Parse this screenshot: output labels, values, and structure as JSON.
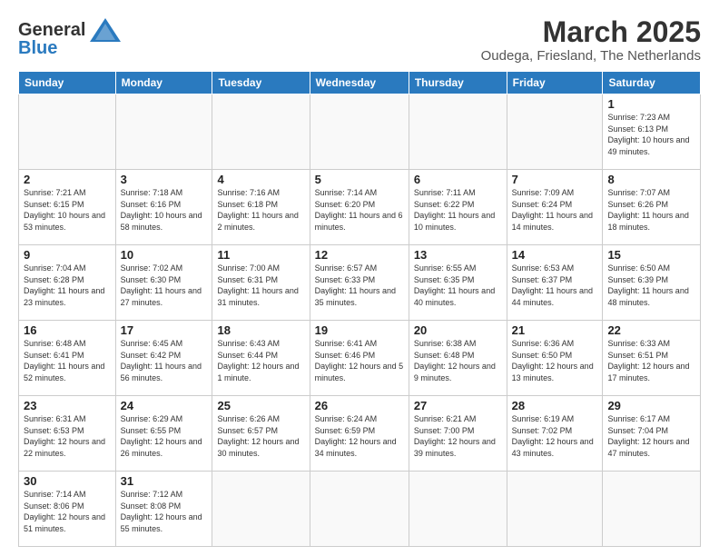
{
  "header": {
    "logo_general": "General",
    "logo_blue": "Blue",
    "title": "March 2025",
    "subtitle": "Oudega, Friesland, The Netherlands"
  },
  "days_of_week": [
    "Sunday",
    "Monday",
    "Tuesday",
    "Wednesday",
    "Thursday",
    "Friday",
    "Saturday"
  ],
  "weeks": [
    [
      {
        "day": "",
        "info": ""
      },
      {
        "day": "",
        "info": ""
      },
      {
        "day": "",
        "info": ""
      },
      {
        "day": "",
        "info": ""
      },
      {
        "day": "",
        "info": ""
      },
      {
        "day": "",
        "info": ""
      },
      {
        "day": "1",
        "info": "Sunrise: 7:23 AM\nSunset: 6:13 PM\nDaylight: 10 hours and 49 minutes."
      }
    ],
    [
      {
        "day": "2",
        "info": "Sunrise: 7:21 AM\nSunset: 6:15 PM\nDaylight: 10 hours and 53 minutes."
      },
      {
        "day": "3",
        "info": "Sunrise: 7:18 AM\nSunset: 6:16 PM\nDaylight: 10 hours and 58 minutes."
      },
      {
        "day": "4",
        "info": "Sunrise: 7:16 AM\nSunset: 6:18 PM\nDaylight: 11 hours and 2 minutes."
      },
      {
        "day": "5",
        "info": "Sunrise: 7:14 AM\nSunset: 6:20 PM\nDaylight: 11 hours and 6 minutes."
      },
      {
        "day": "6",
        "info": "Sunrise: 7:11 AM\nSunset: 6:22 PM\nDaylight: 11 hours and 10 minutes."
      },
      {
        "day": "7",
        "info": "Sunrise: 7:09 AM\nSunset: 6:24 PM\nDaylight: 11 hours and 14 minutes."
      },
      {
        "day": "8",
        "info": "Sunrise: 7:07 AM\nSunset: 6:26 PM\nDaylight: 11 hours and 18 minutes."
      }
    ],
    [
      {
        "day": "9",
        "info": "Sunrise: 7:04 AM\nSunset: 6:28 PM\nDaylight: 11 hours and 23 minutes."
      },
      {
        "day": "10",
        "info": "Sunrise: 7:02 AM\nSunset: 6:30 PM\nDaylight: 11 hours and 27 minutes."
      },
      {
        "day": "11",
        "info": "Sunrise: 7:00 AM\nSunset: 6:31 PM\nDaylight: 11 hours and 31 minutes."
      },
      {
        "day": "12",
        "info": "Sunrise: 6:57 AM\nSunset: 6:33 PM\nDaylight: 11 hours and 35 minutes."
      },
      {
        "day": "13",
        "info": "Sunrise: 6:55 AM\nSunset: 6:35 PM\nDaylight: 11 hours and 40 minutes."
      },
      {
        "day": "14",
        "info": "Sunrise: 6:53 AM\nSunset: 6:37 PM\nDaylight: 11 hours and 44 minutes."
      },
      {
        "day": "15",
        "info": "Sunrise: 6:50 AM\nSunset: 6:39 PM\nDaylight: 11 hours and 48 minutes."
      }
    ],
    [
      {
        "day": "16",
        "info": "Sunrise: 6:48 AM\nSunset: 6:41 PM\nDaylight: 11 hours and 52 minutes."
      },
      {
        "day": "17",
        "info": "Sunrise: 6:45 AM\nSunset: 6:42 PM\nDaylight: 11 hours and 56 minutes."
      },
      {
        "day": "18",
        "info": "Sunrise: 6:43 AM\nSunset: 6:44 PM\nDaylight: 12 hours and 1 minute."
      },
      {
        "day": "19",
        "info": "Sunrise: 6:41 AM\nSunset: 6:46 PM\nDaylight: 12 hours and 5 minutes."
      },
      {
        "day": "20",
        "info": "Sunrise: 6:38 AM\nSunset: 6:48 PM\nDaylight: 12 hours and 9 minutes."
      },
      {
        "day": "21",
        "info": "Sunrise: 6:36 AM\nSunset: 6:50 PM\nDaylight: 12 hours and 13 minutes."
      },
      {
        "day": "22",
        "info": "Sunrise: 6:33 AM\nSunset: 6:51 PM\nDaylight: 12 hours and 17 minutes."
      }
    ],
    [
      {
        "day": "23",
        "info": "Sunrise: 6:31 AM\nSunset: 6:53 PM\nDaylight: 12 hours and 22 minutes."
      },
      {
        "day": "24",
        "info": "Sunrise: 6:29 AM\nSunset: 6:55 PM\nDaylight: 12 hours and 26 minutes."
      },
      {
        "day": "25",
        "info": "Sunrise: 6:26 AM\nSunset: 6:57 PM\nDaylight: 12 hours and 30 minutes."
      },
      {
        "day": "26",
        "info": "Sunrise: 6:24 AM\nSunset: 6:59 PM\nDaylight: 12 hours and 34 minutes."
      },
      {
        "day": "27",
        "info": "Sunrise: 6:21 AM\nSunset: 7:00 PM\nDaylight: 12 hours and 39 minutes."
      },
      {
        "day": "28",
        "info": "Sunrise: 6:19 AM\nSunset: 7:02 PM\nDaylight: 12 hours and 43 minutes."
      },
      {
        "day": "29",
        "info": "Sunrise: 6:17 AM\nSunset: 7:04 PM\nDaylight: 12 hours and 47 minutes."
      }
    ],
    [
      {
        "day": "30",
        "info": "Sunrise: 7:14 AM\nSunset: 8:06 PM\nDaylight: 12 hours and 51 minutes."
      },
      {
        "day": "31",
        "info": "Sunrise: 7:12 AM\nSunset: 8:08 PM\nDaylight: 12 hours and 55 minutes."
      },
      {
        "day": "",
        "info": ""
      },
      {
        "day": "",
        "info": ""
      },
      {
        "day": "",
        "info": ""
      },
      {
        "day": "",
        "info": ""
      },
      {
        "day": "",
        "info": ""
      }
    ]
  ]
}
